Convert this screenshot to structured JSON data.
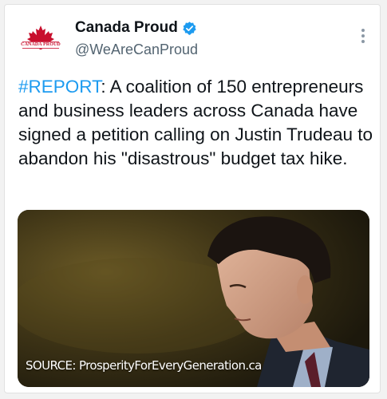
{
  "account": {
    "display_name": "Canada Proud",
    "handle": "@WeAreCanProud",
    "avatar_text": "CANADA PROUD",
    "verified_icon": "verified-badge-icon"
  },
  "tweet": {
    "hashtag": "#REPORT",
    "text": ": A coalition of 150 entrepreneurs and business leaders across Canada have signed a petition calling on Justin Trudeau to abandon his \"disastrous\" budget tax hike."
  },
  "media": {
    "caption": "SOURCE: ProsperityForEveryGeneration.ca"
  },
  "colors": {
    "hashtag": "#1d9bf0",
    "verified": "#1d9bf0",
    "brand_red": "#c8102e"
  }
}
